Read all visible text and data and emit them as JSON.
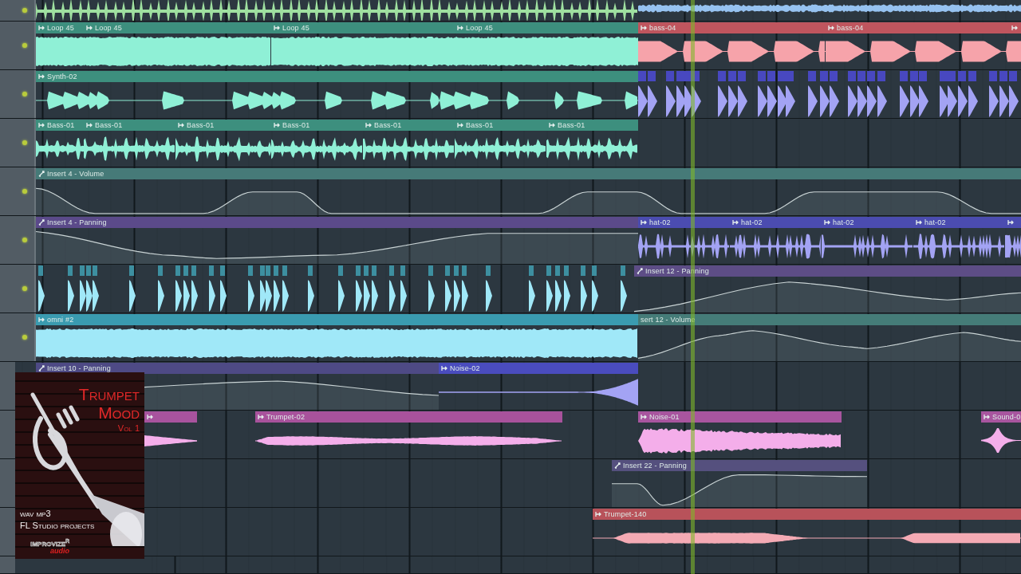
{
  "playlist": {
    "tracks": [
      {
        "clips": [
          {
            "kind": "audio"
          },
          {
            "kind": "audio"
          }
        ]
      },
      {
        "clips": [
          {
            "kind": "audio",
            "label": "Loop 45",
            "color": "#3d8f7e"
          },
          {
            "kind": "audio",
            "label": "Loop 45",
            "color": "#3d8f7e"
          },
          {
            "kind": "audio",
            "label": "Loop 45",
            "color": "#3d8f7e"
          },
          {
            "kind": "audio",
            "label": "Loop 45",
            "color": "#3d8f7e"
          },
          {
            "kind": "audio",
            "label": "bass-04",
            "color": "#bf555e"
          },
          {
            "kind": "audio",
            "label": "bass-04",
            "color": "#bf555e"
          },
          {
            "kind": "audio",
            "color": "#bf555e"
          }
        ]
      },
      {
        "clips": [
          {
            "kind": "audio",
            "label": "Synth-02",
            "color": "#3d8f7e"
          },
          {
            "kind": "slices",
            "color": "#4848c0"
          }
        ]
      },
      {
        "clips": [
          {
            "kind": "audio",
            "label": "Bass-01",
            "color": "#3d8f7e"
          },
          {
            "kind": "audio",
            "label": "Bass-01",
            "color": "#3d8f7e"
          },
          {
            "kind": "audio",
            "label": "Bass-01",
            "color": "#3d8f7e"
          },
          {
            "kind": "audio",
            "label": "Bass-01",
            "color": "#3d8f7e"
          },
          {
            "kind": "audio",
            "label": "Bass-01",
            "color": "#3d8f7e"
          },
          {
            "kind": "audio",
            "label": "Bass-01",
            "color": "#3d8f7e"
          },
          {
            "kind": "audio",
            "label": "Bass-01",
            "color": "#3d8f7e"
          }
        ]
      },
      {
        "clips": [
          {
            "kind": "automation",
            "label": "Insert 4 - Volume",
            "color": "#467a78"
          }
        ]
      },
      {
        "clips": [
          {
            "kind": "automation",
            "label": "Insert 4 - Panning",
            "color": "#5b4a8a"
          },
          {
            "kind": "audio",
            "label": "hat-02",
            "color": "#4b4cb0"
          },
          {
            "kind": "audio",
            "label": "hat-02",
            "color": "#4b4cb0"
          },
          {
            "kind": "audio",
            "label": "hat-02",
            "color": "#4b4cb0"
          },
          {
            "kind": "audio",
            "label": "hat-02",
            "color": "#4b4cb0"
          },
          {
            "kind": "audio",
            "color": "#4b4cb0"
          }
        ]
      },
      {
        "clips": [
          {
            "kind": "slices",
            "color": "#3d8fa0"
          },
          {
            "kind": "automation",
            "label": "Insert 12 - Panning",
            "color": "#5d4d86"
          }
        ]
      },
      {
        "clips": [
          {
            "kind": "audio",
            "label": "omni #2",
            "color": "#3a9bb0"
          },
          {
            "kind": "automation",
            "label": "sert 12 - Volume",
            "color": "#457c78"
          }
        ]
      },
      {
        "clips": [
          {
            "kind": "automation",
            "label": "Insert 10 - Panning",
            "color": "#4e4a85"
          },
          {
            "kind": "audio",
            "label": "Noise-02",
            "color": "#4a4cbe"
          }
        ]
      },
      {
        "clips": [
          {
            "kind": "audio",
            "color": "#a8539e"
          },
          {
            "kind": "audio",
            "label": "Trumpet-02",
            "color": "#a8529c"
          },
          {
            "kind": "audio",
            "label": "Noise-01",
            "color": "#a8559f"
          },
          {
            "kind": "audio",
            "label": "Sound-0",
            "color": "#a8559f"
          }
        ]
      },
      {
        "clips": [
          {
            "kind": "automation",
            "label": "Insert 22 - Panning",
            "color": "#55507e"
          }
        ]
      },
      {
        "clips": [
          {
            "kind": "audio",
            "label": "Trumpet-140",
            "color": "#b8525a"
          }
        ]
      }
    ]
  },
  "cover": {
    "title_lines": [
      "Trumpet",
      "Mood"
    ],
    "volume": "Vol 1",
    "formats": "wav mp3",
    "subtitle": "FL Studio projects",
    "brand": "IMPROVIZE$^{R}$",
    "brand_sub": "audio"
  }
}
